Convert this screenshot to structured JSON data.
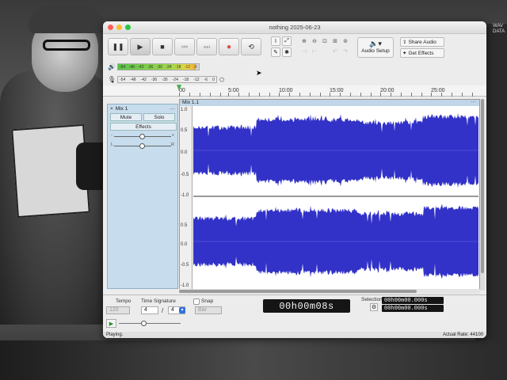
{
  "window": {
    "title": "nothing 2025-06-23"
  },
  "background": {
    "tag_text": "WAV\nDATA"
  },
  "toolbar": {
    "pause_icon": "pause-icon",
    "play_icon": "play-icon",
    "stop_icon": "stop-icon",
    "skip_start_icon": "skip-start-icon",
    "skip_end_icon": "skip-end-icon",
    "record_icon": "record-icon",
    "loop_icon": "loop-icon",
    "audio_setup_label": "Audio Setup",
    "share_audio_label": "Share Audio",
    "get_effects_label": "Get Effects"
  },
  "meters": {
    "playback_scale": [
      "-54",
      "-48",
      "-42",
      "-36",
      "-30",
      "-24",
      "-18",
      "-12",
      "-6"
    ],
    "record_scale": [
      "-54",
      "-48",
      "-42",
      "-36",
      "-30",
      "-24",
      "-18",
      "-12",
      "-6",
      "0"
    ],
    "playback_level": 0.96
  },
  "ruler": {
    "labels": [
      "00",
      "5:00",
      "10:00",
      "15:00",
      "20:00",
      "25:00"
    ]
  },
  "track": {
    "name": "Mix 1",
    "mute_label": "Mute",
    "solo_label": "Solo",
    "effects_label": "Effects",
    "pan_left": "L",
    "pan_right": "R",
    "clip_name": "Mix 1.1"
  },
  "vscale": [
    "1.0",
    "0.5",
    "0.0",
    "-0.5",
    "-1.0",
    "0.5",
    "0.0",
    "-0.5",
    "-1.0"
  ],
  "bottom": {
    "tempo_label": "Tempo",
    "tempo_value": "120",
    "time_sig_label": "Time Signature",
    "time_sig_num": "4",
    "time_sig_den": "4",
    "snap_label": "Snap",
    "snap_value": "Bar",
    "time_display": "00h00m08s",
    "selection_label": "Selection",
    "sel_start": "00h00m00.000s",
    "sel_end": "00h00m00.000s",
    "status_text": "Playing.",
    "actual_rate": "Actual Rate: 44100"
  }
}
